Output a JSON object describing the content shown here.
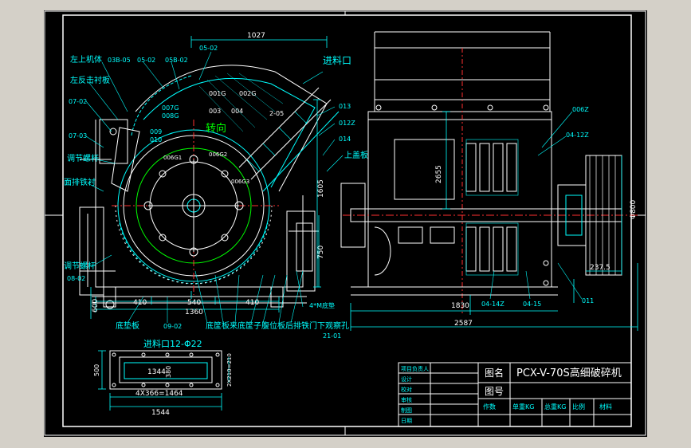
{
  "drawing": {
    "title_block": {
      "machine_name_label": "图名",
      "machine_name": "PCX-V-70S高细破碎机",
      "drawing_no_label": "图号",
      "rows": [
        "项目负责人",
        "设计",
        "校对",
        "审核",
        "制图",
        "日期"
      ],
      "footer": [
        "作数",
        "单重KG",
        "总重KG",
        "比例",
        "材料"
      ]
    },
    "main_labels": {
      "left_upper_body": "左上机体",
      "left_upper_body_code": "03B-05",
      "left_counter_plate": "左反击衬板",
      "code_07_02": "07-02",
      "code_07_03": "07-03",
      "adjust_screw": "调节螺杆",
      "face_liner": "面排铁衬",
      "adjust_screw_2": "调节螺杆",
      "code_08_02": "08-02",
      "code_05_02a": "05-02",
      "code_05_02b": "05-02",
      "code_05B_02": "05B-02",
      "code_007G": "007G",
      "code_008G": "008G",
      "code_009": "009",
      "code_010": "010",
      "code_001G": "001G",
      "code_002G": "002G",
      "code_003": "003",
      "code_004": "004",
      "code_2_05": "2-05",
      "code_006G1": "006G1",
      "code_006G2": "006G2",
      "code_006G3": "006G3",
      "rotation": "转向",
      "feed_inlet": "进料口",
      "code_013": "013",
      "code_012Z": "012Z",
      "code_014": "014",
      "upper_cover": "上盖板",
      "dim_1027": "1027",
      "dim_1605": "1605",
      "dim_750": "750",
      "dim_600": "600",
      "dim_410a": "410",
      "dim_540": "540",
      "dim_410b": "410",
      "dim_1360": "1360",
      "bottom_plate": "底垫板",
      "code_09_02": "09-02",
      "bottom_caption": "底筐板来底筐子腹位板后排铁门下观察孔",
      "code_21_01": "21-01",
      "bolts": "4*M底垫",
      "dim_1830": "1830",
      "dim_2587": "2587",
      "code_04_14Z": "04-14Z",
      "code_04_15": "04-15",
      "code_011": "011",
      "code_006Z": "006Z",
      "code_04_12Z": "04-12Z",
      "dim_2655": "2655",
      "dim_phi800": "Φ800",
      "dim_237_5": "237.5"
    },
    "inlet_detail": {
      "title": "进料口12-Φ22",
      "dim_1344": "1344",
      "dim_380": "380",
      "dim_500": "500",
      "dim_210_210": "2X210=210",
      "dim_4x366": "4X366=1464",
      "dim_1544": "1544"
    }
  },
  "colors": {
    "paper": "#000000",
    "outer": "#d4d0c8",
    "line_white": "#ffffff",
    "line_cyan": "#00ffff",
    "line_green": "#00ff00",
    "line_red": "#ff3030",
    "line_yellow": "#ffff00",
    "line_magenta": "#ff40ff"
  }
}
